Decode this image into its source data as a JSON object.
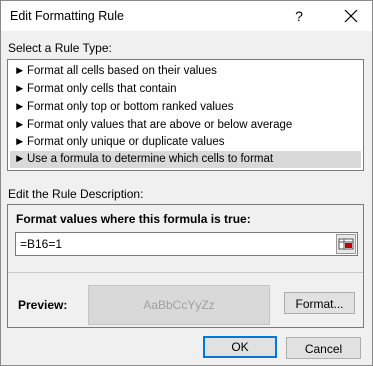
{
  "window": {
    "title": "Edit Formatting Rule",
    "help_glyph": "?"
  },
  "rule_type": {
    "label": "Select a Rule Type:",
    "arrow_glyph": "►",
    "items": [
      {
        "label": "Format all cells based on their values",
        "selected": false
      },
      {
        "label": "Format only cells that contain",
        "selected": false
      },
      {
        "label": "Format only top or bottom ranked values",
        "selected": false
      },
      {
        "label": "Format only values that are above or below average",
        "selected": false
      },
      {
        "label": "Format only unique or duplicate values",
        "selected": false
      },
      {
        "label": "Use a formula to determine which cells to format",
        "selected": true
      }
    ]
  },
  "description": {
    "label": "Edit the Rule Description:",
    "formula_heading": "Format values where this formula is true:",
    "formula_value": "=B16=1",
    "preview_label": "Preview:",
    "preview_sample": "AaBbCcYyZz",
    "format_button": "Format..."
  },
  "buttons": {
    "ok": "OK",
    "cancel": "Cancel"
  },
  "colors": {
    "selected_row": "#d9d9d9",
    "default_button_border": "#0078d7",
    "preview_background": "#d9d9d9"
  },
  "icons": {
    "close": "close-icon",
    "range_selector": "range-selector-icon",
    "rule_bullet": "triangle-right-icon"
  }
}
